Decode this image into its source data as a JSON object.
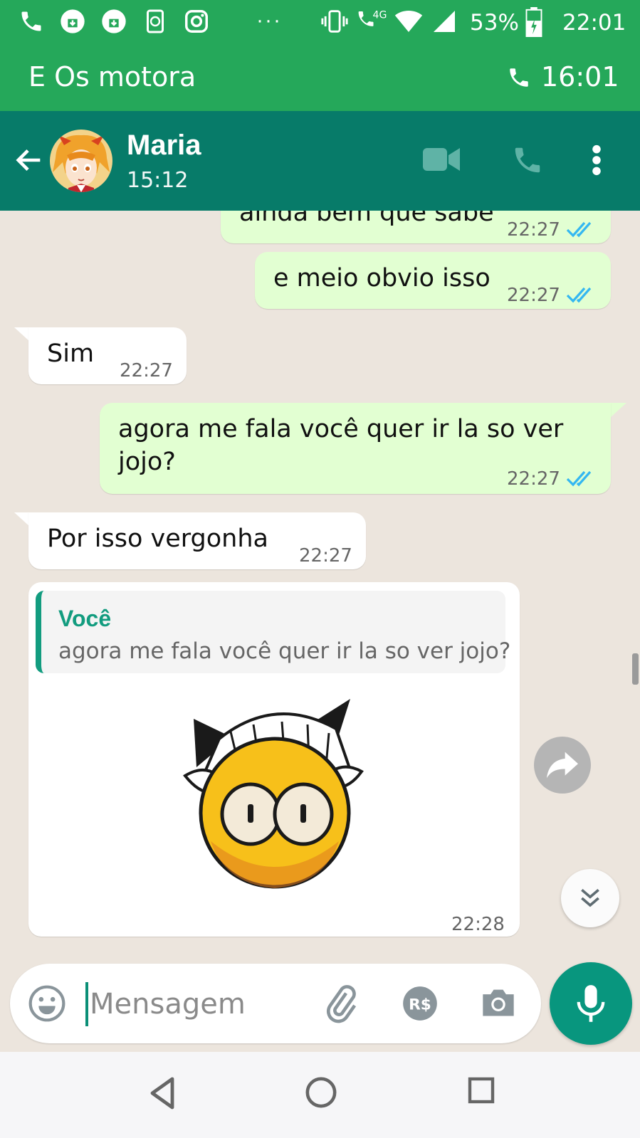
{
  "status_bar": {
    "dots": "···",
    "network": "4G",
    "battery_pct": "53%",
    "time": "22:01",
    "icons": [
      "phone-icon",
      "download-icon",
      "download-icon",
      "phone-sync-icon",
      "instagram-icon",
      "vibrate-icon",
      "wifi-calling-icon",
      "wifi-icon",
      "signal-icon",
      "battery-icon"
    ]
  },
  "call_bar": {
    "group_name": "E Os motora",
    "duration": "16:01"
  },
  "chat_header": {
    "contact_name": "Maria",
    "status": "15:12"
  },
  "messages": [
    {
      "dir": "out",
      "text": "ainda bem que sabe",
      "time": "22:27",
      "ticks": "read"
    },
    {
      "dir": "out",
      "text": "e meio obvio isso",
      "time": "22:27",
      "ticks": "read"
    },
    {
      "dir": "in",
      "text": "Sim",
      "time": "22:27"
    },
    {
      "dir": "out",
      "text": "agora me fala você quer ir la so ver jojo?",
      "time": "22:27",
      "ticks": "read"
    },
    {
      "dir": "in",
      "text": "Por isso vergonha",
      "time": "22:27"
    },
    {
      "dir": "in",
      "type": "sticker-reply",
      "quote_author": "Você",
      "quote_text": "agora me fala você quer ir la so ver jojo?",
      "time": "22:28"
    }
  ],
  "input": {
    "placeholder": "Mensagem"
  },
  "colors": {
    "status_green": "#25a85a",
    "header_teal": "#077b69",
    "outgoing_bubble": "#e2ffd2",
    "incoming_bubble": "#ffffff",
    "read_tick_blue": "#34b7f1",
    "mic_button": "#08967e",
    "chat_background": "#ece5dd"
  }
}
